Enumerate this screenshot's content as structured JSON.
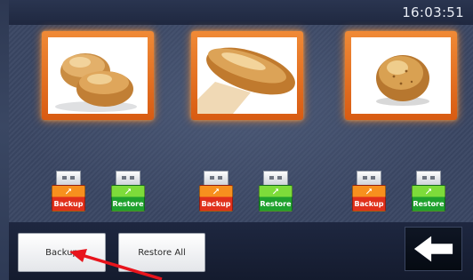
{
  "status_bar": {
    "time": "16:03:51"
  },
  "products": [
    {
      "icon": "bread-rolls-image"
    },
    {
      "icon": "baguette-image"
    },
    {
      "icon": "bun-image"
    }
  ],
  "usb_buttons": {
    "backup_label": "Backup",
    "restore_label": "Restore",
    "usb_symbol": "⭧"
  },
  "footer": {
    "backup_label": "Backup",
    "restore_all_label": "Restore All",
    "back_icon": "arrow-left-icon"
  },
  "colors": {
    "accent_orange": "#e8681a",
    "backup_red": "#e0301b",
    "restore_green": "#1fa12d",
    "annotation_red": "#e8141c"
  }
}
